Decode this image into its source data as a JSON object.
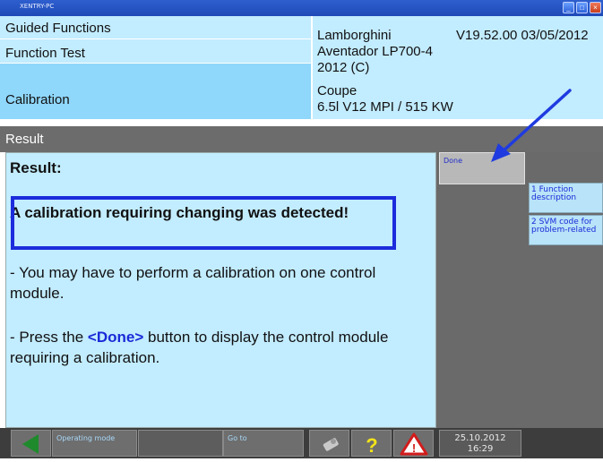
{
  "window": {
    "title": "XENTRY-PC"
  },
  "header": {
    "guided_functions": "Guided Functions",
    "function_test": "Function Test",
    "calibration": "Calibration",
    "vehicle": {
      "make": "Lamborghini",
      "version": "V19.52.00 03/05/2012",
      "model": "Aventador LP700-4",
      "year": "2012 (C)",
      "body": "Coupe",
      "engine": "6.5l V12 MPI / 515 KW"
    }
  },
  "result_bar": {
    "label": "Result"
  },
  "content": {
    "heading": "Result:",
    "detected": "A calibration requiring changing was detected!",
    "line1": "- You may have to perform a calibration on one control module.",
    "line2_prefix": "- Press the ",
    "line2_button": "<Done>",
    "line2_suffix": " button to display the control module requiring a calibration."
  },
  "side_buttons": {
    "done": "Done",
    "function_description": "1 Function description",
    "svm_code": "2 SVM code for problem-related"
  },
  "bottom_bar": {
    "operating_mode": "Operating mode",
    "go_to": "Go to",
    "date": "25.10.2012",
    "time": "16:29"
  },
  "colors": {
    "panel_light": "#c2ecff",
    "panel_selected": "#8fd7fb",
    "highlight_box": "#1c2cdc",
    "arrow": "#1f3be0"
  },
  "icons": [
    "back-arrow-icon",
    "tools-icon",
    "help-icon",
    "warning-icon"
  ]
}
